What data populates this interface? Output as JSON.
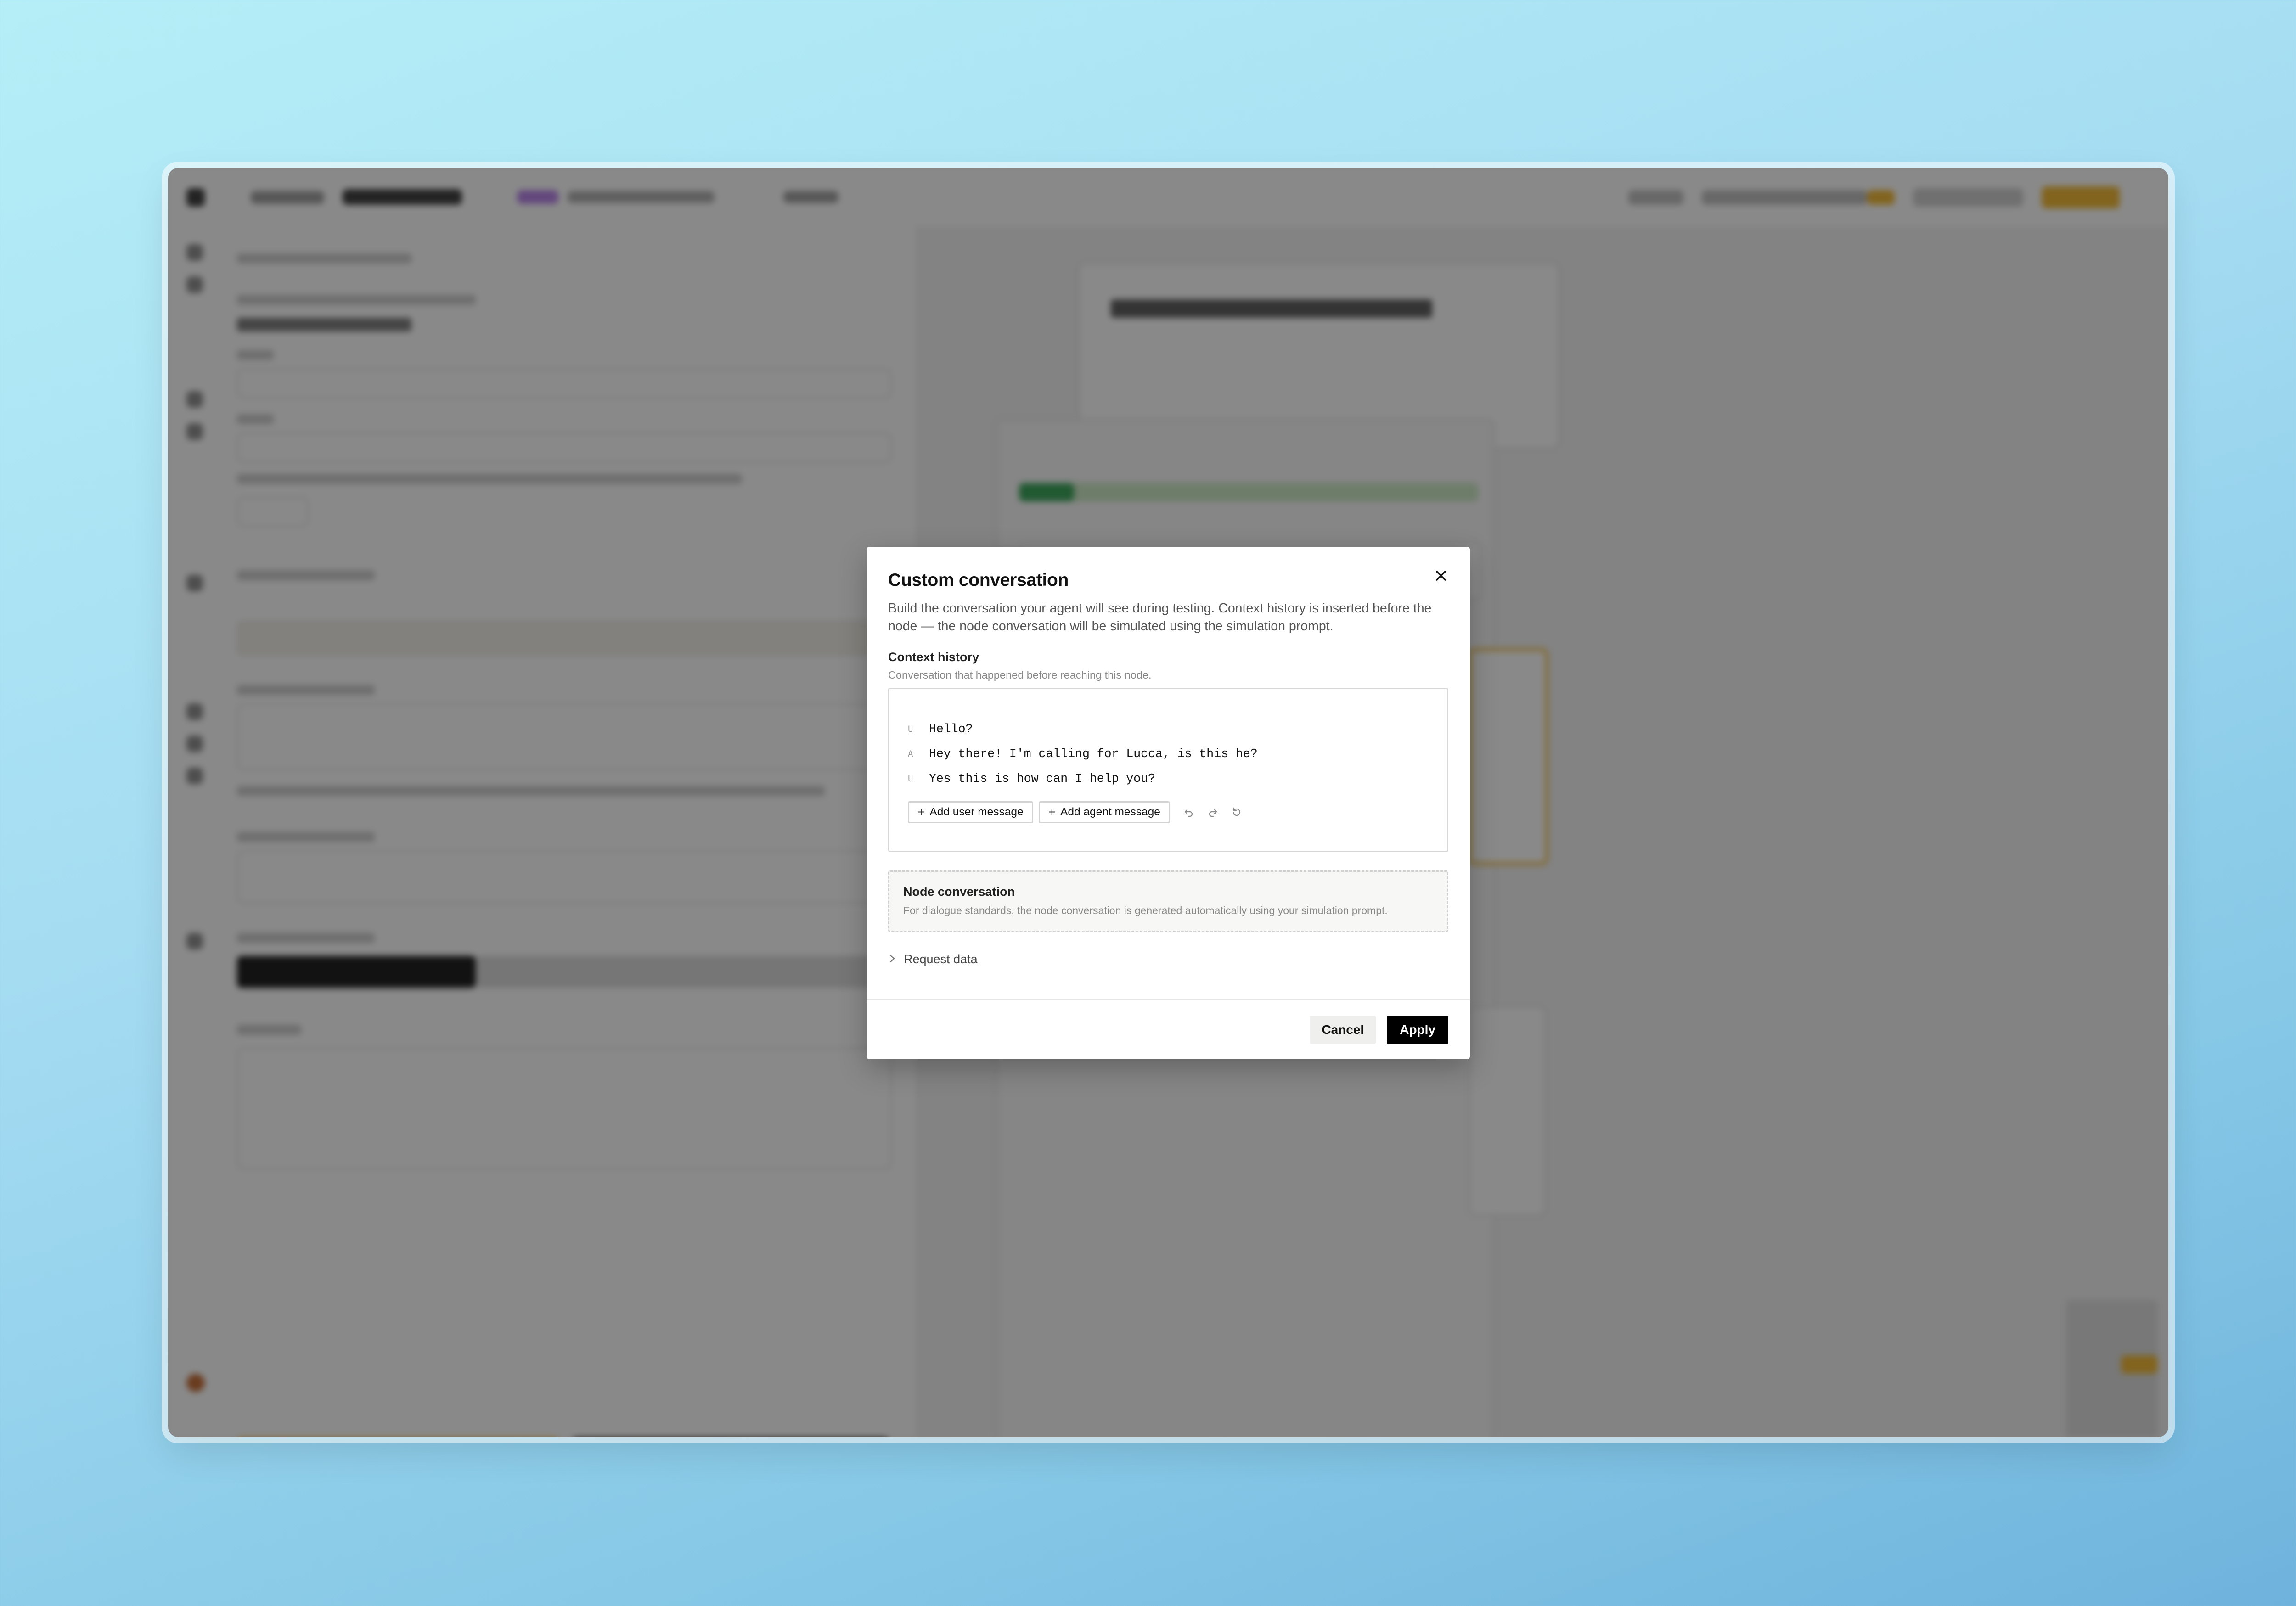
{
  "modal": {
    "title": "Custom conversation",
    "description": "Build the conversation your agent will see during testing. Context history is inserted before the node — the node conversation will be simulated using the simulation prompt.",
    "close_icon": "close-icon",
    "context_history": {
      "label": "Context history",
      "sublabel": "Conversation that happened before reaching this node.",
      "messages": [
        {
          "role": "U",
          "text": "Hello?"
        },
        {
          "role": "A",
          "text": "Hey there! I'm calling for Lucca, is this he?"
        },
        {
          "role": "U",
          "text": "Yes this is how can I help you?"
        }
      ],
      "add_user_label": "Add user message",
      "add_agent_label": "Add agent message",
      "icons": [
        "undo-icon",
        "redo-icon",
        "reset-icon"
      ]
    },
    "node_conversation": {
      "label": "Node conversation",
      "sublabel": "For dialogue standards, the node conversation is generated automatically using your simulation prompt."
    },
    "request_data_label": "Request data",
    "cancel_label": "Cancel",
    "apply_label": "Apply"
  },
  "colors": {
    "accent_yellow": "#f0b429",
    "primary_button": "#000000",
    "scrim": "rgba(20,20,20,0.5)"
  }
}
